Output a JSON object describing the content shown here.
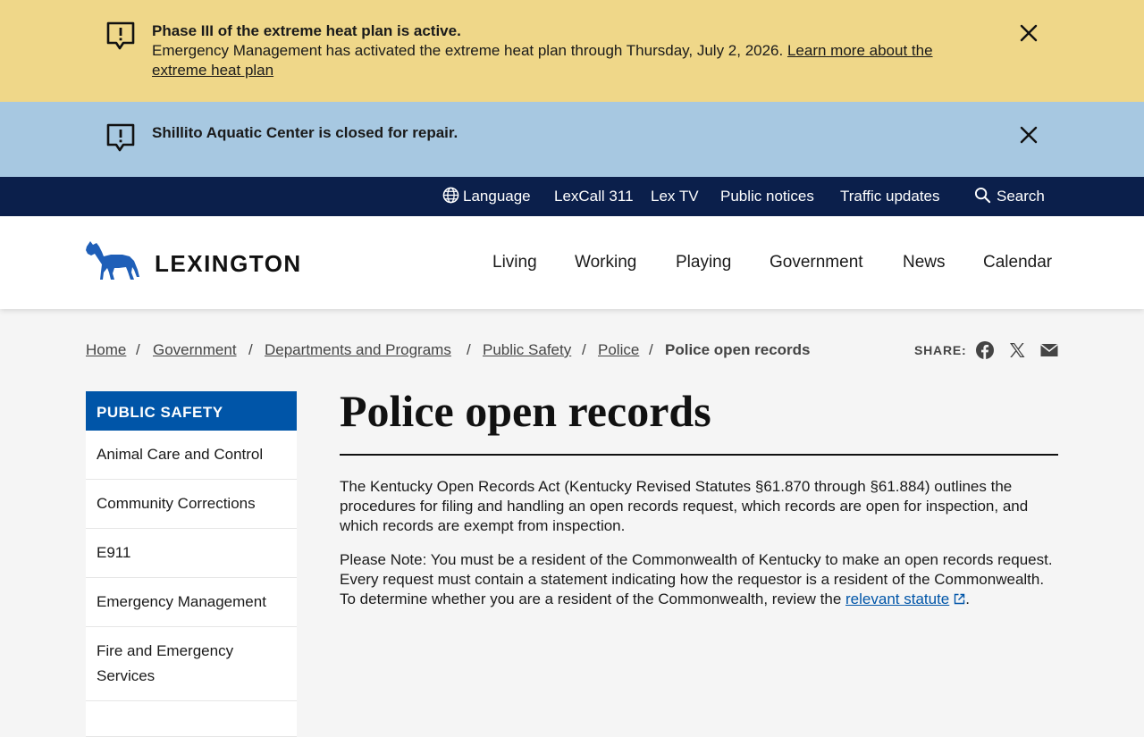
{
  "alerts": [
    {
      "title": "Phase III of the extreme heat plan is active.",
      "text": "Emergency Management has activated the extreme heat plan through Thursday, July 2, 2026. ",
      "link": "Learn more about the extreme heat plan"
    },
    {
      "title": "Shillito Aquatic Center is closed for repair."
    }
  ],
  "utility_nav": {
    "language": "Language",
    "lexcall": "LexCall 311",
    "lextv": "Lex TV",
    "notices": "Public notices",
    "traffic": "Traffic updates",
    "search": "Search"
  },
  "logo": {
    "text": "LEXINGTON"
  },
  "main_nav": [
    "Living",
    "Working",
    "Playing",
    "Government",
    "News",
    "Calendar"
  ],
  "breadcrumb": {
    "items": [
      "Home",
      "Government",
      "Departments and Programs",
      "Public Safety",
      "Police"
    ],
    "separator": "/",
    "current": "Police open records"
  },
  "share": {
    "label": "SHARE:"
  },
  "sidebar": {
    "title": "PUBLIC SAFETY",
    "items": [
      "Animal Care and Control",
      "Community Corrections",
      "E911",
      "Emergency Management",
      "Fire and Emergency Services"
    ]
  },
  "page": {
    "title": "Police open records",
    "paragraph1": "The Kentucky Open Records Act (Kentucky Revised Statutes §61.870 through §61.884) outlines the procedures for filing and handling an open records request, which records are open for inspection, and which records are exempt from inspection.",
    "paragraph2_text": "Please Note: You must be a resident of the Commonwealth of Kentucky to make an open records request. Every request must contain a statement indicating how the requestor is a resident of the Commonwealth. To determine whether you are a resident of the Commonwealth, review the ",
    "paragraph2_link": "relevant statute",
    "paragraph2_end": "."
  },
  "colors": {
    "alert_yellow": "#efd789",
    "alert_blue": "#a7c8e1",
    "utility_bar": "#0b1f4b",
    "brand_blue": "#0055a8"
  }
}
